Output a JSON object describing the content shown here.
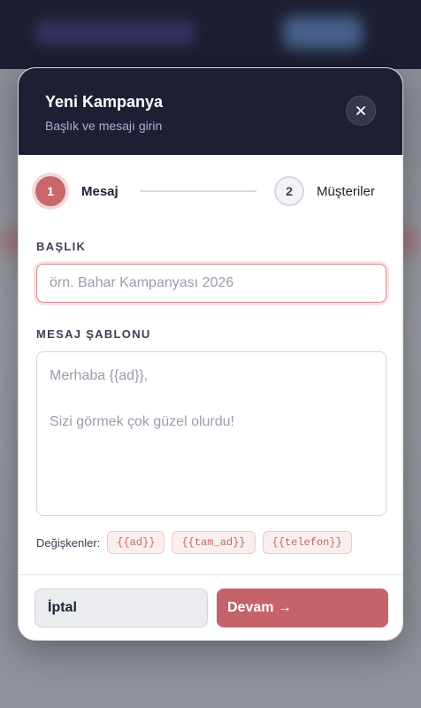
{
  "modal": {
    "title": "Yeni Kampanya",
    "subtitle": "Başlık ve mesajı girin",
    "close_icon": "close-icon"
  },
  "stepper": {
    "steps": [
      {
        "number": "1",
        "label": "Mesaj",
        "state": "active"
      },
      {
        "number": "2",
        "label": "Müşteriler",
        "state": "inactive"
      }
    ]
  },
  "form": {
    "title_label": "BAŞLIK",
    "title_value": "",
    "title_placeholder": "örn. Bahar Kampanyası 2026",
    "template_label": "MESAJ ŞABLONU",
    "template_value": "",
    "template_placeholder": "Merhaba {{ad}},\n\nSizi görmek çok güzel olurdu!",
    "variables_label": "Değişkenler:",
    "variables": [
      "{{ad}}",
      "{{tam_ad}}",
      "{{telefon}}"
    ]
  },
  "footer": {
    "cancel_label": "İptal",
    "continue_label": "Devam →"
  },
  "colors": {
    "header_bg": "#1d2033",
    "accent": "#c4646a",
    "accent_soft": "#fbeeee"
  }
}
